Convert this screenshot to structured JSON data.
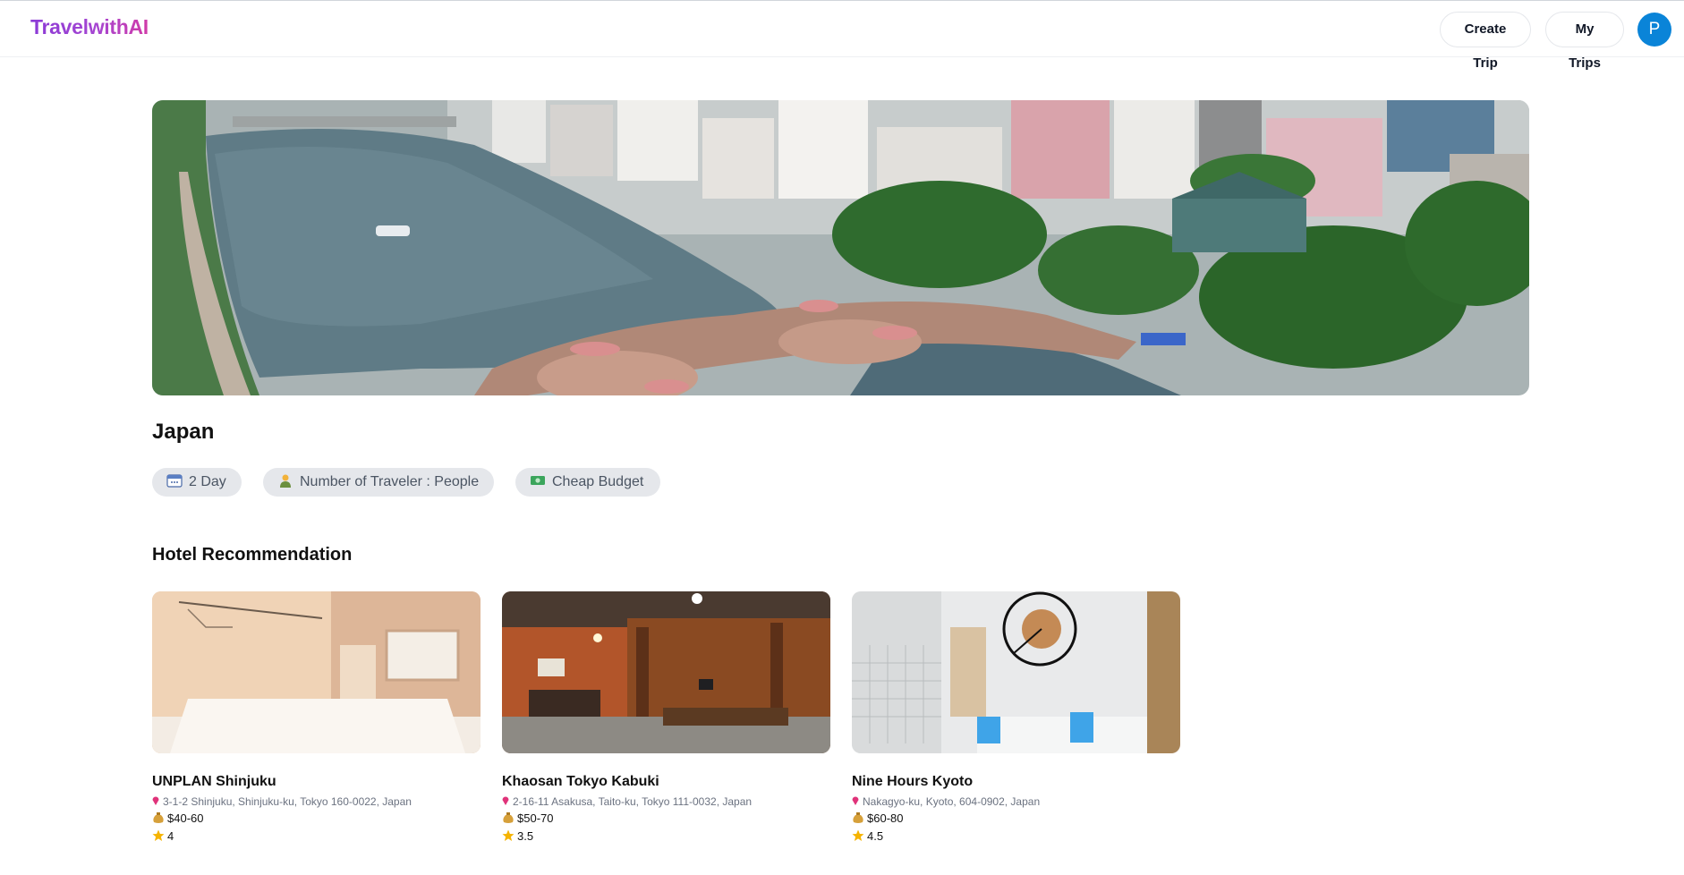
{
  "brand": {
    "name": "TravelwithAI"
  },
  "header": {
    "create_trip_label": "Create Trip",
    "my_trips_label": "My Trips",
    "avatar_initial": "P"
  },
  "trip": {
    "destination": "Japan",
    "chips": {
      "days": "2 Day",
      "travelers": "Number of Traveler : People",
      "budget": "Cheap Budget"
    }
  },
  "hotels_section": {
    "title": "Hotel Recommendation",
    "hotels": [
      {
        "name": "UNPLAN Shinjuku",
        "address": "3-1-2 Shinjuku, Shinjuku-ku, Tokyo 160-0022, Japan",
        "price": "$40-60",
        "rating": "4"
      },
      {
        "name": "Khaosan Tokyo Kabuki",
        "address": "2-16-11 Asakusa, Taito-ku, Tokyo 111-0032, Japan",
        "price": "$50-70",
        "rating": "3.5"
      },
      {
        "name": "Nine Hours Kyoto",
        "address": "Nakagyo-ku, Kyoto, 604-0902, Japan",
        "price": "$60-80",
        "rating": "4.5"
      }
    ]
  },
  "hero_image": {
    "alt": "city river view"
  },
  "icons": {
    "calendar": "calendar-icon",
    "traveler": "person-icon",
    "money": "cash-icon",
    "pin": "location-pin-icon",
    "money_bag": "money-bag-icon",
    "star": "star-icon"
  },
  "colors": {
    "brand_gradient_start": "#8b3bd6",
    "brand_gradient_end": "#d13ba8",
    "avatar": "#0a84d8",
    "chip_bg": "#e5e7eb"
  }
}
